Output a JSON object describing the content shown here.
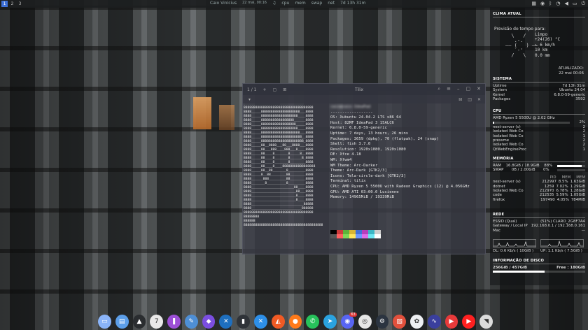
{
  "top_panel": {
    "workspaces": [
      "1",
      "2",
      "3"
    ],
    "active_workspace": 0,
    "user": "Caio Vinícius",
    "datetime": "22 mai, 00:16",
    "cpu_label": "cpu",
    "mem_label": "mem",
    "swap_label": "swap",
    "net_label": "net",
    "uptime": "7d 13h 31m"
  },
  "terminal": {
    "tab_counter": "1 / 1",
    "title": "Tilix",
    "ascii_art": [
      "888888888888888888888888888888888888",
      "8888_____88888888888888888888___8888",
      "8888_____8888888888888888888____8888",
      "8888_____88888888888888888______8888",
      "8888_____888888888888888888_____8888",
      "8888_____8888888888888888888____8888",
      "8888_____88888888888888888888___8888",
      "8888_____888888888888888888888__8888",
      "8888_____8888888888888888888888_8888",
      "8888_____88__8888___88___8888___8888",
      "8888_____88___888____888___8____8888",
      "8888_____88____8_______8_____8__8888",
      "8888_____88____8_______8______8_8888",
      "8888_____88____8_______8________8888",
      "8888_____88____8____88888888888888888",
      "8888_____88__88_______8_________8888",
      "8888_____8__88________88________8888",
      "8888______888_________88________8888",
      "8888_______8__________8_________8888",
      "8888______________________88____8888",
      "8888_______________________88___8888",
      "8888_______________________8____8888",
      "8888_______________________8____8888",
      "8888___________________________88888",
      "8888__________________________888888",
      "888888888888888888888888888888888888",
      "88888888",
      "888888",
      "88888888888888888888888888888888888888888"
    ],
    "sysinfo_header": "caio@caio-IdeaPad",
    "separator": "------------------",
    "sysinfo": [
      "OS: Xubuntu 24.04.2 LTS x86_64",
      "Host: 82MF IdeaPad 3 15ALC6",
      "Kernel: 6.8.0-59-generic",
      "Uptime: 7 days, 13 hours, 26 mins",
      "Packages: 3659 (dpkg), 70 (flatpak), 24 (snap)",
      "Shell: fish 3.7.0",
      "Resolution: 1920x1080, 1920x1080",
      "DE: Xfce 4.18",
      "WM: Xfwm4",
      "WM Theme: Arc-Darker",
      "Theme: Arc-Dark [GTK2/3]",
      "Icons: Tela-circle-dark [GTK2/3]",
      "Terminal: tilix",
      "CPU: AMD Ryzen 5 5500U with Radeon Graphics (12) @ 4.056GHz",
      "GPU: AMD ATI 03:00.0 Lucienne",
      "Memory: 14965MiB / 19339MiB"
    ],
    "palette_row1": [
      "#000000",
      "#cc3b3b",
      "#5fb33a",
      "#d8b534",
      "#3f6fd9",
      "#b73dbd",
      "#3bb7c6",
      "#d0d0d0"
    ],
    "palette_row2": [
      "#555555",
      "#ff5f5f",
      "#7fd857",
      "#ffe45c",
      "#6c97ff",
      "#e06ce8",
      "#6ce6f2",
      "#ffffff"
    ]
  },
  "conky": {
    "weather": {
      "title": "CLIMA ATUAL",
      "forecast_label": "Previsão do tempo para:",
      "condition": "Limpo",
      "temperature": "+24(26) °C",
      "wind": "↖ 6 km/h",
      "visibility": "10 km",
      "precip": "0.0 mm",
      "updated_label": "ATUALIZADO:",
      "updated_value": "22 mai 00:06"
    },
    "system": {
      "title": "SISTEMA",
      "rows": [
        {
          "label": "Uptime",
          "value": "7d 13h 31m"
        },
        {
          "label": "System",
          "value": "Ubuntu 24.04"
        },
        {
          "label": "Kernel",
          "value": "6.8.0-59-generic"
        },
        {
          "label": "Packages",
          "value": "3592"
        }
      ]
    },
    "cpu": {
      "title": "CPU",
      "model": "AMD Ryzen 5 5500U @ 2.02 GHz",
      "percent": "2%",
      "load_fraction": 0.02,
      "processes": [
        {
          "name": "nest-server (v)",
          "value": "2"
        },
        {
          "name": "Isolated Web Co",
          "value": "2"
        },
        {
          "name": "Isolated Web Co",
          "value": "1"
        },
        {
          "name": "pressme",
          "value": "2"
        },
        {
          "name": "Isolated Web Co",
          "value": "2"
        },
        {
          "name": "QtWebEngineProc",
          "value": "1"
        }
      ]
    },
    "memory": {
      "title": "MEMÓRIA",
      "ram_label": "RAM",
      "ram_value": "16.8GiB / 18.9GiB",
      "ram_percent": "88%",
      "ram_fraction": 0.88,
      "swap_label": "SWAP",
      "swap_value": "0B / 2.00GiB",
      "swap_percent": "0%",
      "swap_fraction": 0.0,
      "columns": [
        "PID",
        "MEM",
        "MEM"
      ],
      "processes": [
        {
          "name": "nest-server (v)",
          "pid": "212997",
          "pct": "8.5%",
          "mem": "1.63GiB"
        },
        {
          "name": "dotnet",
          "pid": "1259",
          "pct": "7.02%",
          "mem": "1.29GiB"
        },
        {
          "name": "Isolated Web Co",
          "pid": "212970",
          "pct": "6.78%",
          "mem": "1.28GiB"
        },
        {
          "name": "code",
          "pid": "212535",
          "pct": "5.59%",
          "mem": "1.05GiB"
        },
        {
          "name": "firefox",
          "pid": "197490",
          "pct": "4.05%",
          "mem": "784MiB"
        }
      ]
    },
    "network": {
      "title": "REDE",
      "ssid_label": "ESSID (Qual)",
      "ssid_value": "(51%) CLARO_2G8F7A4",
      "gateway_label": "Gateway / Local IP",
      "gateway_value": "192.168.0.1 / 192.168.0.161",
      "mac_label": "Mac",
      "mac_value": "—",
      "down": "DL: 0.6 Kb/s ( 10GiB )",
      "up": "UP: 1.1 Kb/s ( 7.5GiB )"
    },
    "disk": {
      "title": "INFORMAÇÃO DE DISCO",
      "used": "256GiB / 457GiB",
      "free": "Free : 180GiB",
      "used_fraction": 0.56
    }
  },
  "dock": {
    "icons": [
      {
        "name": "files-icon",
        "color": "#8ab4f8",
        "glyph": "▭"
      },
      {
        "name": "folder-icon",
        "color": "#5c9ee8",
        "glyph": "▤"
      },
      {
        "name": "google-drive-icon",
        "color": "#2a2d30",
        "glyph": "▲"
      },
      {
        "name": "calendar-icon",
        "color": "#e9e9e9",
        "glyph": "7"
      },
      {
        "name": "podcast-icon",
        "color": "#9c4fd6",
        "glyph": "❚"
      },
      {
        "name": "notes-icon",
        "color": "#4e8fd6",
        "glyph": "✎"
      },
      {
        "name": "proton-vpn-icon",
        "color": "#7b4ee0",
        "glyph": "◆"
      },
      {
        "name": "vscode-icon",
        "color": "#1e6fbf",
        "glyph": "✕"
      },
      {
        "name": "terminal-icon",
        "color": "#2f3338",
        "glyph": "▮"
      },
      {
        "name": "remote-desktop-icon",
        "color": "#2d8fe8",
        "glyph": "✕"
      },
      {
        "name": "brave-icon",
        "color": "#f05a24",
        "glyph": "◭"
      },
      {
        "name": "firefox-icon",
        "color": "#ff7a1a",
        "glyph": "●"
      },
      {
        "name": "whatsapp-icon",
        "color": "#27c25b",
        "glyph": "✆"
      },
      {
        "name": "telegram-icon",
        "color": "#2aa3e0",
        "glyph": "➤"
      },
      {
        "name": "discord-icon",
        "color": "#5865f2",
        "glyph": "◉",
        "badge": "63"
      },
      {
        "name": "camera-icon",
        "color": "#e6e6e6",
        "glyph": "◎"
      },
      {
        "name": "steam-icon",
        "color": "#2b3440",
        "glyph": "⚙"
      },
      {
        "name": "image-viewer-icon",
        "color": "#e2503c",
        "glyph": "▧"
      },
      {
        "name": "flower-icon",
        "color": "#eef0f2",
        "glyph": "✿"
      },
      {
        "name": "audio-icon",
        "color": "#3a3f9e",
        "glyph": "∿"
      },
      {
        "name": "video-icon",
        "color": "#e83a3a",
        "glyph": "▶"
      },
      {
        "name": "youtube-icon",
        "color": "#ff2020",
        "glyph": "▶"
      },
      {
        "name": "budgie-icon",
        "color": "#dcdcdc",
        "glyph": "◥"
      }
    ]
  }
}
